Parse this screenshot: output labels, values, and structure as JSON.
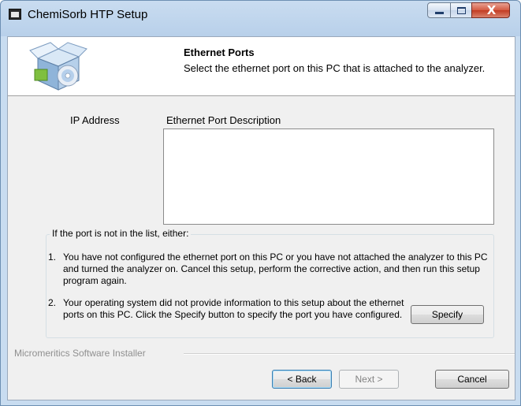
{
  "window": {
    "title": "ChemiSorb HTP Setup",
    "controls": {
      "minimize": "minimize",
      "maximize": "maximize",
      "close": "X"
    }
  },
  "header": {
    "title": "Ethernet Ports",
    "subtitle": "Select the ethernet port on this PC that is attached to the analyzer."
  },
  "ports_list": {
    "columns": [
      "IP Address",
      "Ethernet Port Description"
    ],
    "rows": []
  },
  "help_group": {
    "legend": "If the port is not in the list, either:",
    "items": [
      {
        "number": "1.",
        "text": "You have not configured the ethernet port on this PC or you have not attached the analyzer to this PC and turned the analyzer on. Cancel this setup, perform the corrective action, and then run this setup program again."
      },
      {
        "number": "2.",
        "text": "Your operating system did not provide information to this setup about the ethernet ports on this PC. Click the Specify button to specify the port you have configured."
      }
    ],
    "specify_label": "Specify"
  },
  "footer": {
    "brand": "Micromeritics Software Installer",
    "back_label": "< Back",
    "next_label": "Next >",
    "cancel_label": "Cancel"
  },
  "colors": {
    "accent": "#3c7fb1",
    "close_button": "#c23b22",
    "dialog_bg": "#f0f0f0"
  },
  "icons": [
    "app-icon",
    "installer-box-icon"
  ]
}
